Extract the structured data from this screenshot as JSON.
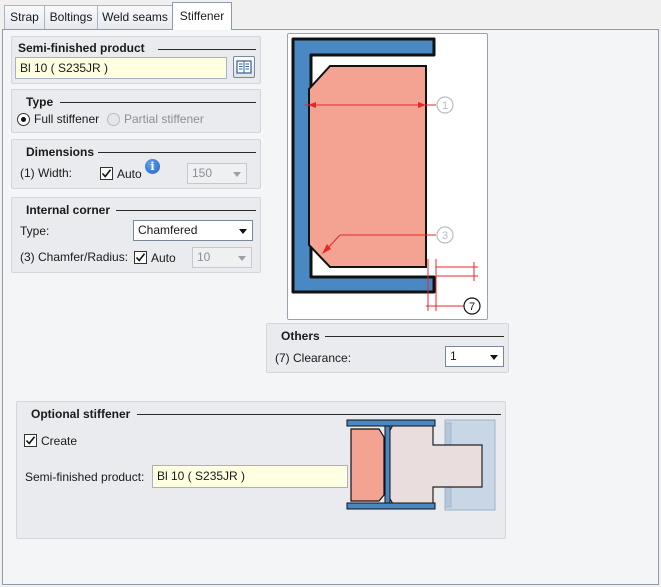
{
  "tabs": [
    {
      "label": "Strap"
    },
    {
      "label": "Boltings"
    },
    {
      "label": "Weld seams"
    },
    {
      "label": "Stiffener"
    }
  ],
  "semi_finished": {
    "title": "Semi-finished product",
    "value": "Bl 10  ( S235JR )"
  },
  "type_group": {
    "title": "Type",
    "full_label": "Full stiffener",
    "partial_label": "Partial stiffener",
    "full_selected": true,
    "partial_enabled": false
  },
  "dimensions": {
    "title": "Dimensions",
    "width_label": "(1) Width:",
    "auto_label": "Auto",
    "auto_checked": true,
    "width_value": "150"
  },
  "internal_corner": {
    "title": "Internal corner",
    "type_label": "Type:",
    "type_value": "Chamfered",
    "chamfer_label": "(3) Chamfer/Radius:",
    "auto_label": "Auto",
    "auto_checked": true,
    "chamfer_value": "10"
  },
  "diagram": {
    "marker_1": "1",
    "marker_3": "3",
    "marker_7": "7"
  },
  "others": {
    "title": "Others",
    "clearance_label": "(7) Clearance:",
    "clearance_value": "1"
  },
  "optional_stiffener": {
    "title": "Optional stiffener",
    "create_label": "Create",
    "create_checked": true,
    "product_label": "Semi-finished product:",
    "product_value": "Bl 10  ( S235JR )"
  },
  "colors": {
    "steel_blue": "#4a88c4",
    "plate_fill": "#f4a292",
    "field_yellow": "#ffffe1",
    "dim_red": "#e8262d"
  }
}
